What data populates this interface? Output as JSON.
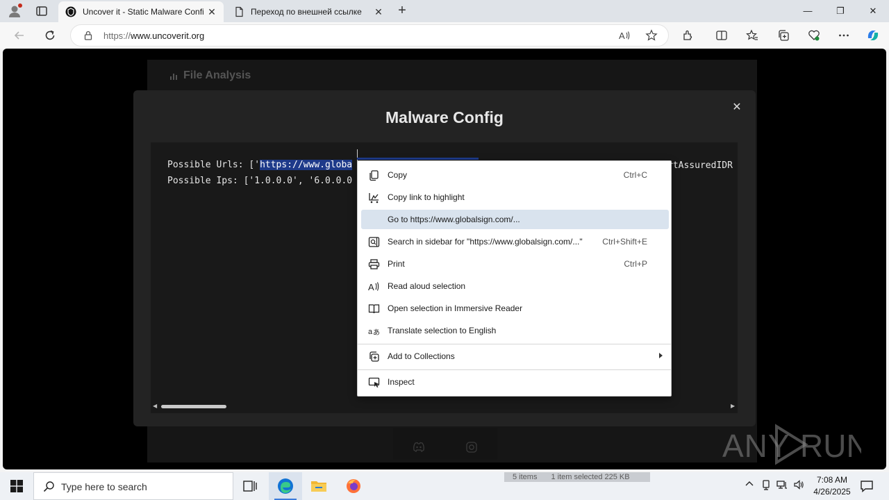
{
  "browser": {
    "tabs": [
      {
        "title": "Uncover it - Static Malware Confi",
        "icon": "uncoverit-favicon",
        "active": true
      },
      {
        "title": "Переход по внешней ссылке",
        "icon": "page-icon",
        "active": false
      }
    ],
    "new_tab_glyph": "+",
    "window_controls": {
      "minimize": "—",
      "maximize": "❐",
      "close": "✕"
    },
    "address": {
      "scheme": "https://",
      "host": "www.uncoverit.org"
    }
  },
  "page": {
    "background_title": "File Analysis",
    "modal": {
      "title": "Malware Config",
      "close_glyph": "✕",
      "lines": {
        "urls_prefix": "Possible Urls: ['",
        "urls_selected": "https://www.globa",
        "urls_tail": "rtAssuredIDR",
        "ips": "Possible Ips: ['1.0.0.0', '6.0.0.0"
      }
    }
  },
  "context_menu": {
    "items": [
      {
        "label": "Copy",
        "shortcut": "Ctrl+C",
        "icon": "copy-icon"
      },
      {
        "label": "Copy link to highlight",
        "shortcut": "",
        "icon": "link-highlight-icon"
      },
      {
        "label": "Go to https://www.globalsign.com/...",
        "shortcut": "",
        "icon": ""
      },
      {
        "label": "Search in sidebar for \"https://www.globalsign.com/...\"",
        "shortcut": "Ctrl+Shift+E",
        "icon": "sidebar-search-icon"
      },
      {
        "label": "Print",
        "shortcut": "Ctrl+P",
        "icon": "print-icon"
      },
      {
        "label": "Read aloud selection",
        "shortcut": "",
        "icon": "read-aloud-icon"
      },
      {
        "label": "Open selection in Immersive Reader",
        "shortcut": "",
        "icon": "immersive-reader-icon"
      },
      {
        "label": "Translate selection to English",
        "shortcut": "",
        "icon": "translate-icon"
      },
      {
        "label": "Add to Collections",
        "shortcut": "",
        "icon": "collections-icon"
      },
      {
        "label": "Inspect",
        "shortcut": "",
        "icon": "inspect-icon"
      }
    ]
  },
  "watermark": {
    "text": "ANY RUN"
  },
  "taskbar": {
    "search_placeholder": "Type here to search",
    "ghost_status": {
      "items": "5 items",
      "selected": "1 item selected  225 KB"
    },
    "clock": {
      "time": "7:08 AM",
      "date": "4/26/2025"
    }
  },
  "colors": {
    "selection": "#1e3a8a",
    "menu_hover": "#d9e3ee",
    "modal_bg": "#232323",
    "accent": "#3b7ad9"
  }
}
